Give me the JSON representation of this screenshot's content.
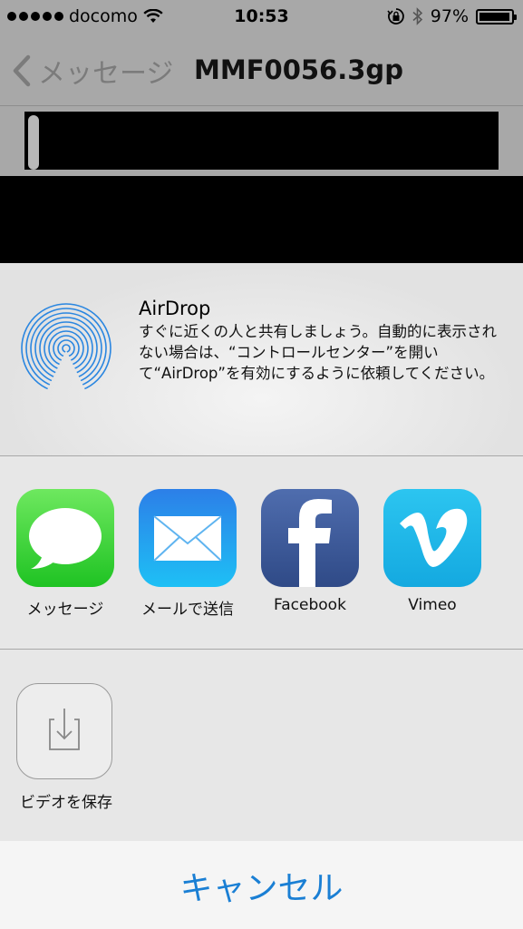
{
  "status_bar": {
    "carrier": "docomo",
    "time": "10:53",
    "battery_percent": "97%",
    "battery_level": 0.97,
    "signal_bars": 5
  },
  "nav": {
    "back_label": "メッセージ",
    "title": "MMF0056.3gp"
  },
  "share_sheet": {
    "airdrop": {
      "title": "AirDrop",
      "description": "すぐに近くの人と共有しましょう。自動的に表示されない場合は、“コントロールセンター”を開いて“AirDrop”を有効にするように依頼してください。"
    },
    "apps": [
      {
        "label": "メッセージ",
        "icon": "messages-icon"
      },
      {
        "label": "メールで送信",
        "icon": "mail-icon"
      },
      {
        "label": "Facebook",
        "icon": "facebook-icon"
      },
      {
        "label": "Vimeo",
        "icon": "vimeo-icon"
      }
    ],
    "actions": [
      {
        "label": "ビデオを保存",
        "icon": "save-video-icon"
      }
    ],
    "cancel_label": "キャンセル"
  },
  "colors": {
    "accent": "#1a7fd4",
    "messages_green": "#3fd63a",
    "mail_blue": "#1d8ef0",
    "facebook_blue": "#3b5998",
    "vimeo_blue": "#1ab7ea"
  }
}
